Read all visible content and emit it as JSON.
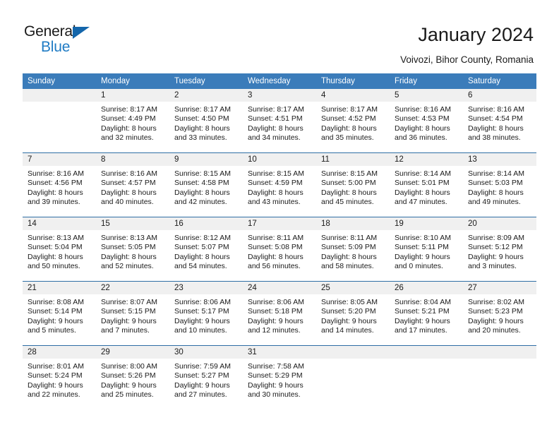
{
  "brand": {
    "name_primary": "General",
    "name_secondary": "Blue",
    "triangle_color": "#1466ab",
    "secondary_color": "#1f7bc4"
  },
  "header": {
    "title": "January 2024",
    "subtitle": "Voivozi, Bihor County, Romania"
  },
  "theme": {
    "header_bg": "#3b7cba",
    "daynum_bg": "#f0f0f0",
    "separator": "#2f6ea5",
    "text": "#1a1a1a"
  },
  "calendar": {
    "weekday_headers": [
      "Sunday",
      "Monday",
      "Tuesday",
      "Wednesday",
      "Thursday",
      "Friday",
      "Saturday"
    ],
    "weeks": [
      [
        {
          "day": "",
          "sunrise": "",
          "sunset": "",
          "daylight_line1": "",
          "daylight_line2": ""
        },
        {
          "day": "1",
          "sunrise": "Sunrise: 8:17 AM",
          "sunset": "Sunset: 4:49 PM",
          "daylight_line1": "Daylight: 8 hours",
          "daylight_line2": "and 32 minutes."
        },
        {
          "day": "2",
          "sunrise": "Sunrise: 8:17 AM",
          "sunset": "Sunset: 4:50 PM",
          "daylight_line1": "Daylight: 8 hours",
          "daylight_line2": "and 33 minutes."
        },
        {
          "day": "3",
          "sunrise": "Sunrise: 8:17 AM",
          "sunset": "Sunset: 4:51 PM",
          "daylight_line1": "Daylight: 8 hours",
          "daylight_line2": "and 34 minutes."
        },
        {
          "day": "4",
          "sunrise": "Sunrise: 8:17 AM",
          "sunset": "Sunset: 4:52 PM",
          "daylight_line1": "Daylight: 8 hours",
          "daylight_line2": "and 35 minutes."
        },
        {
          "day": "5",
          "sunrise": "Sunrise: 8:16 AM",
          "sunset": "Sunset: 4:53 PM",
          "daylight_line1": "Daylight: 8 hours",
          "daylight_line2": "and 36 minutes."
        },
        {
          "day": "6",
          "sunrise": "Sunrise: 8:16 AM",
          "sunset": "Sunset: 4:54 PM",
          "daylight_line1": "Daylight: 8 hours",
          "daylight_line2": "and 38 minutes."
        }
      ],
      [
        {
          "day": "7",
          "sunrise": "Sunrise: 8:16 AM",
          "sunset": "Sunset: 4:56 PM",
          "daylight_line1": "Daylight: 8 hours",
          "daylight_line2": "and 39 minutes."
        },
        {
          "day": "8",
          "sunrise": "Sunrise: 8:16 AM",
          "sunset": "Sunset: 4:57 PM",
          "daylight_line1": "Daylight: 8 hours",
          "daylight_line2": "and 40 minutes."
        },
        {
          "day": "9",
          "sunrise": "Sunrise: 8:15 AM",
          "sunset": "Sunset: 4:58 PM",
          "daylight_line1": "Daylight: 8 hours",
          "daylight_line2": "and 42 minutes."
        },
        {
          "day": "10",
          "sunrise": "Sunrise: 8:15 AM",
          "sunset": "Sunset: 4:59 PM",
          "daylight_line1": "Daylight: 8 hours",
          "daylight_line2": "and 43 minutes."
        },
        {
          "day": "11",
          "sunrise": "Sunrise: 8:15 AM",
          "sunset": "Sunset: 5:00 PM",
          "daylight_line1": "Daylight: 8 hours",
          "daylight_line2": "and 45 minutes."
        },
        {
          "day": "12",
          "sunrise": "Sunrise: 8:14 AM",
          "sunset": "Sunset: 5:01 PM",
          "daylight_line1": "Daylight: 8 hours",
          "daylight_line2": "and 47 minutes."
        },
        {
          "day": "13",
          "sunrise": "Sunrise: 8:14 AM",
          "sunset": "Sunset: 5:03 PM",
          "daylight_line1": "Daylight: 8 hours",
          "daylight_line2": "and 49 minutes."
        }
      ],
      [
        {
          "day": "14",
          "sunrise": "Sunrise: 8:13 AM",
          "sunset": "Sunset: 5:04 PM",
          "daylight_line1": "Daylight: 8 hours",
          "daylight_line2": "and 50 minutes."
        },
        {
          "day": "15",
          "sunrise": "Sunrise: 8:13 AM",
          "sunset": "Sunset: 5:05 PM",
          "daylight_line1": "Daylight: 8 hours",
          "daylight_line2": "and 52 minutes."
        },
        {
          "day": "16",
          "sunrise": "Sunrise: 8:12 AM",
          "sunset": "Sunset: 5:07 PM",
          "daylight_line1": "Daylight: 8 hours",
          "daylight_line2": "and 54 minutes."
        },
        {
          "day": "17",
          "sunrise": "Sunrise: 8:11 AM",
          "sunset": "Sunset: 5:08 PM",
          "daylight_line1": "Daylight: 8 hours",
          "daylight_line2": "and 56 minutes."
        },
        {
          "day": "18",
          "sunrise": "Sunrise: 8:11 AM",
          "sunset": "Sunset: 5:09 PM",
          "daylight_line1": "Daylight: 8 hours",
          "daylight_line2": "and 58 minutes."
        },
        {
          "day": "19",
          "sunrise": "Sunrise: 8:10 AM",
          "sunset": "Sunset: 5:11 PM",
          "daylight_line1": "Daylight: 9 hours",
          "daylight_line2": "and 0 minutes."
        },
        {
          "day": "20",
          "sunrise": "Sunrise: 8:09 AM",
          "sunset": "Sunset: 5:12 PM",
          "daylight_line1": "Daylight: 9 hours",
          "daylight_line2": "and 3 minutes."
        }
      ],
      [
        {
          "day": "21",
          "sunrise": "Sunrise: 8:08 AM",
          "sunset": "Sunset: 5:14 PM",
          "daylight_line1": "Daylight: 9 hours",
          "daylight_line2": "and 5 minutes."
        },
        {
          "day": "22",
          "sunrise": "Sunrise: 8:07 AM",
          "sunset": "Sunset: 5:15 PM",
          "daylight_line1": "Daylight: 9 hours",
          "daylight_line2": "and 7 minutes."
        },
        {
          "day": "23",
          "sunrise": "Sunrise: 8:06 AM",
          "sunset": "Sunset: 5:17 PM",
          "daylight_line1": "Daylight: 9 hours",
          "daylight_line2": "and 10 minutes."
        },
        {
          "day": "24",
          "sunrise": "Sunrise: 8:06 AM",
          "sunset": "Sunset: 5:18 PM",
          "daylight_line1": "Daylight: 9 hours",
          "daylight_line2": "and 12 minutes."
        },
        {
          "day": "25",
          "sunrise": "Sunrise: 8:05 AM",
          "sunset": "Sunset: 5:20 PM",
          "daylight_line1": "Daylight: 9 hours",
          "daylight_line2": "and 14 minutes."
        },
        {
          "day": "26",
          "sunrise": "Sunrise: 8:04 AM",
          "sunset": "Sunset: 5:21 PM",
          "daylight_line1": "Daylight: 9 hours",
          "daylight_line2": "and 17 minutes."
        },
        {
          "day": "27",
          "sunrise": "Sunrise: 8:02 AM",
          "sunset": "Sunset: 5:23 PM",
          "daylight_line1": "Daylight: 9 hours",
          "daylight_line2": "and 20 minutes."
        }
      ],
      [
        {
          "day": "28",
          "sunrise": "Sunrise: 8:01 AM",
          "sunset": "Sunset: 5:24 PM",
          "daylight_line1": "Daylight: 9 hours",
          "daylight_line2": "and 22 minutes."
        },
        {
          "day": "29",
          "sunrise": "Sunrise: 8:00 AM",
          "sunset": "Sunset: 5:26 PM",
          "daylight_line1": "Daylight: 9 hours",
          "daylight_line2": "and 25 minutes."
        },
        {
          "day": "30",
          "sunrise": "Sunrise: 7:59 AM",
          "sunset": "Sunset: 5:27 PM",
          "daylight_line1": "Daylight: 9 hours",
          "daylight_line2": "and 27 minutes."
        },
        {
          "day": "31",
          "sunrise": "Sunrise: 7:58 AM",
          "sunset": "Sunset: 5:29 PM",
          "daylight_line1": "Daylight: 9 hours",
          "daylight_line2": "and 30 minutes."
        },
        {
          "day": "",
          "sunrise": "",
          "sunset": "",
          "daylight_line1": "",
          "daylight_line2": ""
        },
        {
          "day": "",
          "sunrise": "",
          "sunset": "",
          "daylight_line1": "",
          "daylight_line2": ""
        },
        {
          "day": "",
          "sunrise": "",
          "sunset": "",
          "daylight_line1": "",
          "daylight_line2": ""
        }
      ]
    ]
  }
}
